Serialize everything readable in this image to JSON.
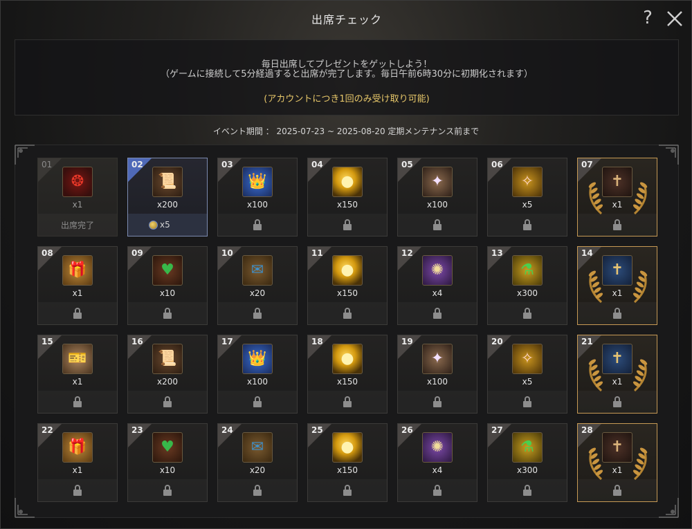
{
  "window": {
    "title": "出席チェック",
    "help_label": "?"
  },
  "info": {
    "line1": "毎日出席してプレゼントをゲットしよう！",
    "line2": "（ゲームに接続して5分経過すると出席が完了します。毎日午前6時30分に初期化されます）",
    "note": "(アカウントにつき1回のみ受け取り可能)"
  },
  "period": {
    "text": "イベント期間 ： 2025-07-23 ~ 2025-08-20 定期メンテナンス前まで"
  },
  "colors": {
    "accent_gold": "#e8c86a",
    "milestone_border": "#c79a55",
    "today_border": "#7c8bb0",
    "today_tab": "#4f69b8"
  },
  "days": [
    {
      "day": "01",
      "qty": "x1",
      "icon": "red-wreath-icon",
      "glyph": "❂",
      "palette": "ic-wreath",
      "status": "done",
      "status_text": "出席完了"
    },
    {
      "day": "02",
      "qty": "x200",
      "icon": "scroll-icon",
      "glyph": "📜",
      "palette": "ic-scroll",
      "status": "today",
      "bonus": "x5"
    },
    {
      "day": "03",
      "qty": "x100",
      "icon": "treasure-chest-icon",
      "glyph": "👑",
      "palette": "ic-chest",
      "status": "locked"
    },
    {
      "day": "04",
      "qty": "x150",
      "icon": "gold-orb-icon",
      "glyph": "●",
      "palette": "ic-orb",
      "status": "locked"
    },
    {
      "day": "05",
      "qty": "x100",
      "icon": "crystal-shard-icon",
      "glyph": "✦",
      "palette": "ic-shard",
      "status": "locked"
    },
    {
      "day": "06",
      "qty": "x5",
      "icon": "feather-icon",
      "glyph": "✧",
      "palette": "ic-feather",
      "status": "locked"
    },
    {
      "day": "07",
      "qty": "x1",
      "icon": "card-pack-icon",
      "glyph": "✝",
      "palette": "ic-card-dark",
      "status": "locked",
      "milestone": true
    },
    {
      "day": "08",
      "qty": "x1",
      "icon": "gift-box-icon",
      "glyph": "🎁",
      "palette": "ic-gift",
      "status": "locked"
    },
    {
      "day": "09",
      "qty": "x10",
      "icon": "green-heart-icon",
      "glyph": "♥",
      "palette": "ic-heart",
      "status": "locked"
    },
    {
      "day": "10",
      "qty": "x20",
      "icon": "map-scroll-icon",
      "glyph": "✉",
      "palette": "ic-map",
      "status": "locked"
    },
    {
      "day": "11",
      "qty": "x150",
      "icon": "gold-orb-icon",
      "glyph": "●",
      "palette": "ic-orb",
      "status": "locked"
    },
    {
      "day": "12",
      "qty": "x4",
      "icon": "rune-stone-icon",
      "glyph": "✺",
      "palette": "ic-rune",
      "status": "locked"
    },
    {
      "day": "13",
      "qty": "x300",
      "icon": "green-potion-icon",
      "glyph": "⚗",
      "palette": "ic-potion",
      "status": "locked"
    },
    {
      "day": "14",
      "qty": "x1",
      "icon": "blue-card-icon",
      "glyph": "✝",
      "palette": "ic-card-blue",
      "status": "locked",
      "milestone": true
    },
    {
      "day": "15",
      "qty": "x1",
      "icon": "ticket-icon",
      "glyph": "🎫",
      "palette": "ic-ticket",
      "status": "locked"
    },
    {
      "day": "16",
      "qty": "x200",
      "icon": "scroll-icon",
      "glyph": "📜",
      "palette": "ic-scroll",
      "status": "locked"
    },
    {
      "day": "17",
      "qty": "x100",
      "icon": "treasure-chest-icon",
      "glyph": "👑",
      "palette": "ic-chest",
      "status": "locked"
    },
    {
      "day": "18",
      "qty": "x150",
      "icon": "gold-orb-icon",
      "glyph": "●",
      "palette": "ic-orb",
      "status": "locked"
    },
    {
      "day": "19",
      "qty": "x100",
      "icon": "crystal-shard-icon",
      "glyph": "✦",
      "palette": "ic-shard",
      "status": "locked"
    },
    {
      "day": "20",
      "qty": "x5",
      "icon": "feather-icon",
      "glyph": "✧",
      "palette": "ic-feather",
      "status": "locked"
    },
    {
      "day": "21",
      "qty": "x1",
      "icon": "blue-card-icon",
      "glyph": "✝",
      "palette": "ic-card-blue",
      "status": "locked",
      "milestone": true
    },
    {
      "day": "22",
      "qty": "x1",
      "icon": "gift-box-icon",
      "glyph": "🎁",
      "palette": "ic-gift",
      "status": "locked"
    },
    {
      "day": "23",
      "qty": "x10",
      "icon": "green-heart-icon",
      "glyph": "♥",
      "palette": "ic-heart",
      "status": "locked"
    },
    {
      "day": "24",
      "qty": "x20",
      "icon": "map-scroll-icon",
      "glyph": "✉",
      "palette": "ic-map",
      "status": "locked"
    },
    {
      "day": "25",
      "qty": "x150",
      "icon": "gold-orb-icon",
      "glyph": "●",
      "palette": "ic-orb",
      "status": "locked"
    },
    {
      "day": "26",
      "qty": "x4",
      "icon": "rune-stone-icon",
      "glyph": "✺",
      "palette": "ic-rune",
      "status": "locked"
    },
    {
      "day": "27",
      "qty": "x300",
      "icon": "green-potion-icon",
      "glyph": "⚗",
      "palette": "ic-potion",
      "status": "locked"
    },
    {
      "day": "28",
      "qty": "x1",
      "icon": "card-pack-icon",
      "glyph": "✝",
      "palette": "ic-card-dark",
      "status": "locked",
      "milestone": true
    }
  ]
}
